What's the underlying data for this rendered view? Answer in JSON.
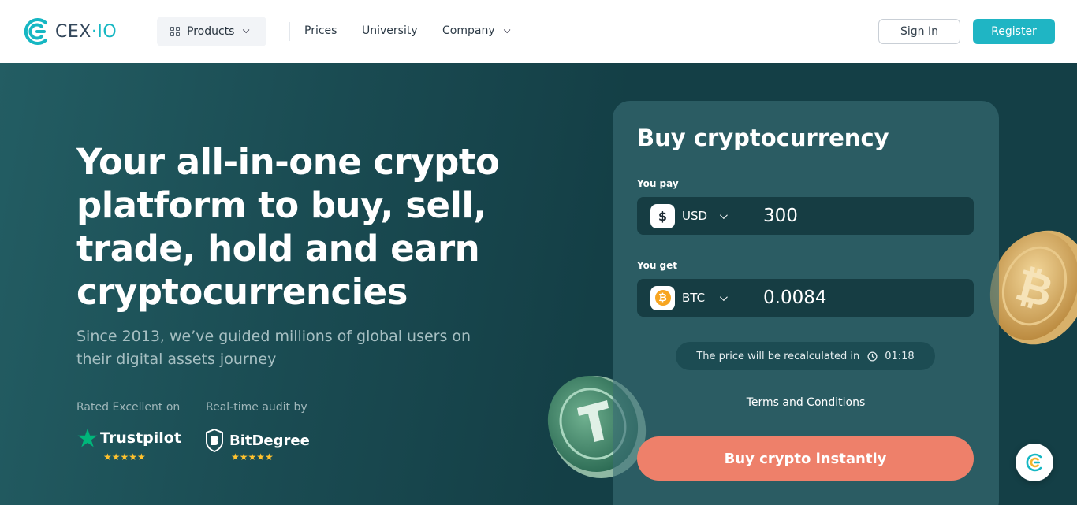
{
  "header": {
    "logo_text": "CEX",
    "logo_suffix": "IO",
    "nav": {
      "products_label": "Products",
      "prices_label": "Prices",
      "university_label": "University",
      "company_label": "Company"
    },
    "sign_in_label": "Sign In",
    "register_label": "Register"
  },
  "hero": {
    "title": "Your all-in-one crypto platform to buy, sell, trade, hold and earn cryptocurrencies",
    "subtitle": "Since 2013, we’ve guided millions of global users on their digital assets journey",
    "ratings": {
      "trustpilot_label": "Rated Excellent on",
      "trustpilot_name": "Trustpilot",
      "trustpilot_stars": "★★★★★",
      "trustpilot_rating": 5,
      "bitdegree_label": "Real-time audit by",
      "bitdegree_name": "BitDegree",
      "bitdegree_stars": "★★★★★",
      "bitdegree_rating": 5
    }
  },
  "buy_card": {
    "title": "Buy cryptocurrency",
    "pay": {
      "label": "You pay",
      "currency_symbol": "$",
      "currency": "USD",
      "amount": "300"
    },
    "get": {
      "label": "You get",
      "currency_symbol": "₿",
      "currency": "BTC",
      "amount": "0.0084"
    },
    "recalc_text": "The price will be recalculated in",
    "recalc_timer": "01:18",
    "terms_label": "Terms and Conditions",
    "buy_button_label": "Buy crypto instantly"
  },
  "icons": {
    "logo": "cex-logo-icon",
    "products": "grid-icon",
    "dropdown": "chevron-down-icon",
    "clock": "clock-icon",
    "chat": "chat-widget-icon"
  },
  "colors": {
    "brand_teal": "#1fb5c4",
    "hero_bg": "#143f46",
    "buy_button": "#ee806a",
    "star_gold": "#ffc22e",
    "trustpilot_green": "#00b67a"
  }
}
